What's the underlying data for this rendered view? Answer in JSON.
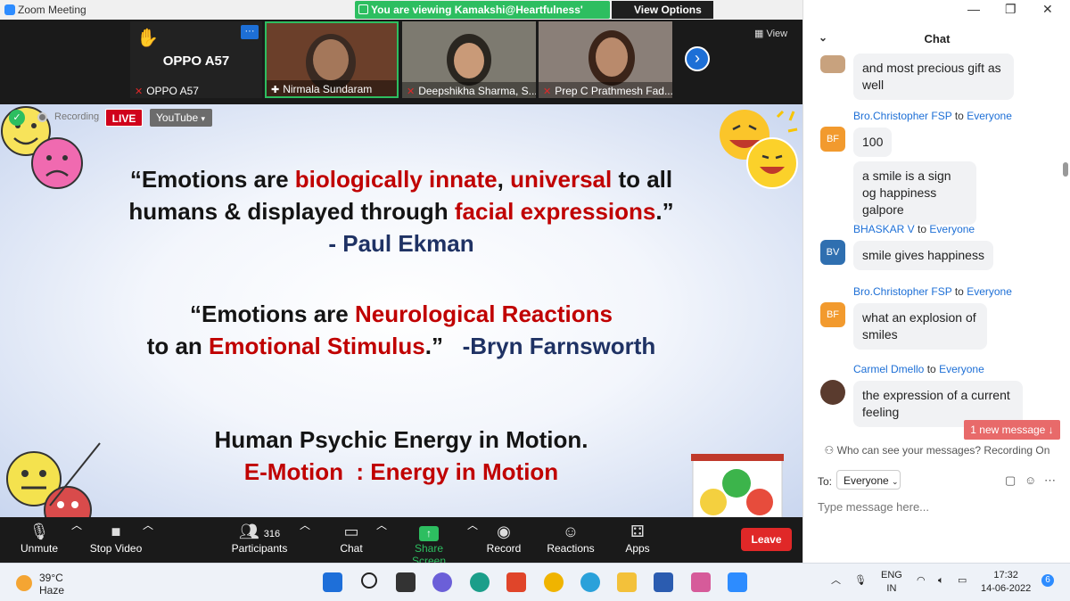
{
  "window": {
    "title": "Zoom Meeting"
  },
  "banner": {
    "text": "You are viewing Kamakshi@Heartfulness' screen",
    "view_options": "View Options ⌄"
  },
  "gallery": {
    "tiles": [
      {
        "big_name": "OPPO A57",
        "name": "OPPO A57",
        "more": "···"
      },
      {
        "name": "Nirmala Sundaram"
      },
      {
        "name": "Deepshikha Sharma, S..."
      },
      {
        "name": "Prep C Prathmesh Fad..."
      }
    ],
    "view_label": "View"
  },
  "recording": {
    "label": "Recording",
    "live": "LIVE",
    "platform": "YouTube"
  },
  "slide": {
    "q1": {
      "p1": "“Emotions are ",
      "r1": "biologically innate",
      "p2": ", ",
      "r2": "universal",
      "p3": " to all",
      "p4": "humans & displayed through ",
      "r3": "facial expressions",
      "p5": ".”",
      "author": "- Paul Ekman"
    },
    "q2": {
      "p1": "“Emotions are ",
      "r1": "Neurological Reactions",
      "p2": "to an ",
      "r2": "Emotional Stimulus",
      "p3": ".”   ",
      "author": "-Bryn Farnsworth"
    },
    "q3": {
      "line1": "Human Psychic Energy in Motion.",
      "line2": "E-Motion  : Energy in Motion"
    }
  },
  "toolbar": {
    "unmute": "Unmute",
    "stop_video": "Stop Video",
    "participants": "Participants",
    "participant_count": "316",
    "chat": "Chat",
    "share_screen": "Share Screen",
    "record": "Record",
    "reactions": "Reactions",
    "apps": "Apps",
    "leave": "Leave"
  },
  "chat": {
    "title": "Chat",
    "messages": [
      {
        "bubble": "and most precious gift as well"
      },
      {
        "sender": "Bro.Christopher FSP",
        "to": "to",
        "recipient": "Everyone",
        "initials": "BF",
        "bubbles": [
          "100",
          "a smile is a sign og happiness galpore"
        ]
      },
      {
        "sender": "BHASKAR V",
        "to": "to",
        "recipient": "Everyone",
        "initials": "BV",
        "bubbles": [
          "smile gives happiness"
        ]
      },
      {
        "sender": "Bro.Christopher FSP",
        "to": "to",
        "recipient": "Everyone",
        "initials": "BF",
        "bubbles": [
          "what an explosion of smiles"
        ]
      },
      {
        "sender": "Carmel Dmello",
        "to": "to",
        "recipient": "Everyone",
        "bubbles": [
          "the expression of a current feeling"
        ]
      }
    ],
    "new_message": "1 new message ↓",
    "who_can_see": "Who can see your messages? Recording On",
    "to_label": "To:",
    "to_value": "Everyone",
    "placeholder": "Type message here..."
  },
  "taskbar": {
    "weather_temp": "39°C",
    "weather_desc": "Haze",
    "lang1": "ENG",
    "lang2": "IN",
    "time": "17:32",
    "date": "14-06-2022",
    "notif": "6"
  },
  "colors": {
    "accent": "#2d8cff",
    "green": "#2dbe60",
    "red": "#e02828",
    "slide_red": "#c00000",
    "slide_navy": "#1f3264"
  }
}
